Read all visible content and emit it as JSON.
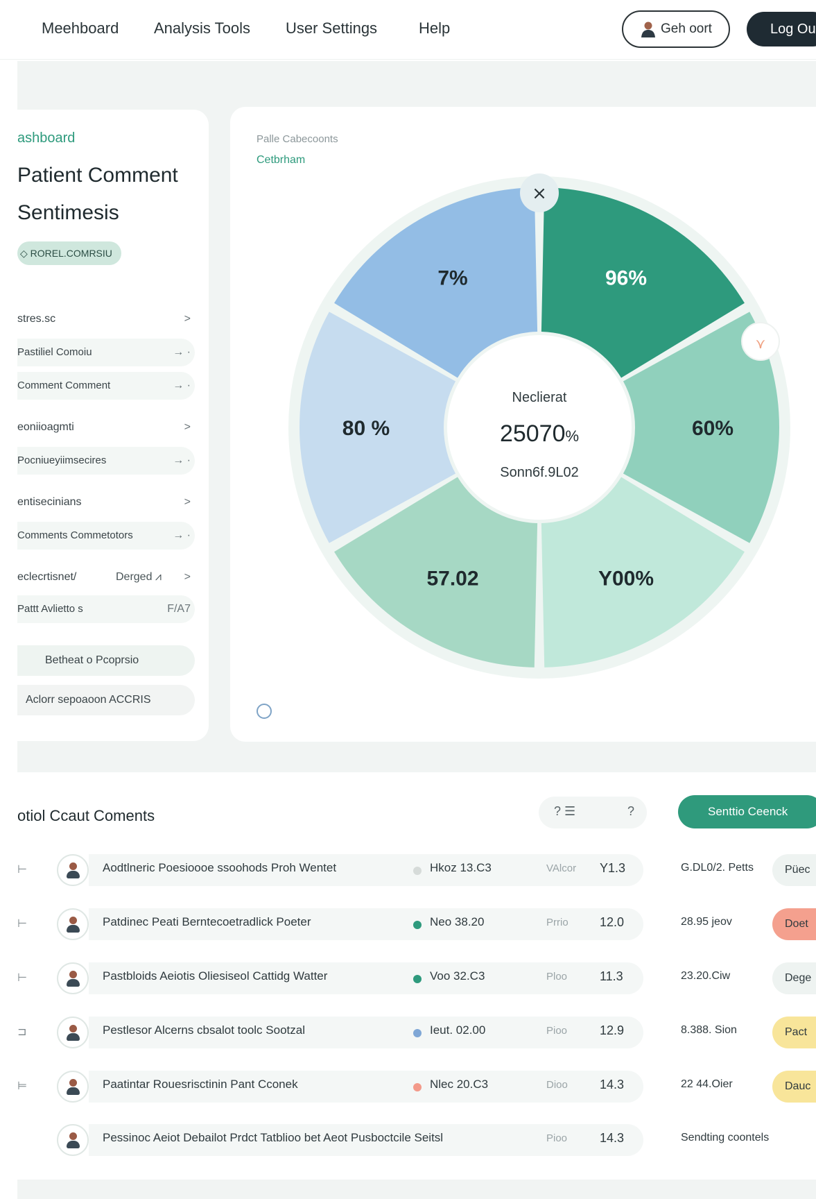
{
  "nav": {
    "items": [
      "Meehboard",
      "Analysis Tools",
      "User Settings",
      "Help"
    ],
    "account_label": "Geh oort",
    "logout_label": "Log Ou"
  },
  "sidebar": {
    "crumb": "ashboard",
    "title_line1": "Patient Comment",
    "title_line2": "Sentimesis",
    "chip_label": "ROREL.COMRSIU",
    "rows": [
      {
        "label": "stres.sc",
        "arrow": ">",
        "sub": false
      },
      {
        "label": "Pastiliel Comoiu",
        "arrow": "→ ·",
        "sub": true
      },
      {
        "label": "Comment Comment",
        "arrow": "→ ·",
        "sub": true
      },
      {
        "label": "eoniioagmti",
        "arrow": ">",
        "sub": false
      },
      {
        "label": "Pocniueyiimsecires",
        "arrow": "→ ·",
        "sub": true
      },
      {
        "label": "entisecinians",
        "arrow": ">",
        "sub": false
      },
      {
        "label": "Comments Commetotors",
        "arrow": "→ ·",
        "sub": true
      },
      {
        "label": "eclecrtisnet/",
        "extra": "Derged ⩘",
        "arrow": ">",
        "sub": false
      },
      {
        "label": "Pattt Avlietto s",
        "arrow": "F/A7",
        "sub": true
      }
    ],
    "actions": [
      "Betheat o Pcoprsio",
      "Aclorr sepoaoon ACCRIS"
    ]
  },
  "chart": {
    "label": "Palle Cabecoonts",
    "sublabel": "Cetbrham",
    "close_icon": "×",
    "marker_icon": "⋎",
    "center_top": "Neclierat",
    "center_value": "25070",
    "center_unit": "%",
    "center_bottom": "Sonn6f.9L02"
  },
  "chart_data": {
    "type": "pie",
    "style": "donut",
    "segments": [
      {
        "label": "96%",
        "value": 96,
        "color": "#2e9a7d"
      },
      {
        "label": "60%",
        "value": 60,
        "color": "#90d0bc"
      },
      {
        "label": "Y00%",
        "value": 100,
        "color": "#c0e8da"
      },
      {
        "label": "57.02",
        "value": 57.02,
        "color": "#a6d8c4"
      },
      {
        "label": "80 %",
        "value": 80,
        "color": "#c6dcef"
      },
      {
        "label": "7%",
        "value": 7,
        "color": "#93bde5"
      }
    ],
    "center_value": "25070%",
    "center_labels": [
      "Neclierat",
      "Sonn6f.9L02"
    ]
  },
  "comments": {
    "title": "otiol Ccaut Coments",
    "filter_left": "? ☰",
    "filter_right": "?",
    "action_label": "Senttio Ceenck",
    "rows": [
      {
        "mark": "⊢",
        "name": "Aodtlneric Poesioooe ssoohods Proh Wentet",
        "dot": "#d6dbd9",
        "date": "Hkoz 13.C3",
        "lbl": "VAlcor",
        "val": "Y1.3",
        "extra": "G.DL0/2. Petts",
        "badge": "Püec",
        "badge_color": "#eef3f1"
      },
      {
        "mark": "⊢",
        "name": "Patdinec Peati Berntecoetradlick Poeter",
        "dot": "#2e9a7d",
        "date": "Neo 38.20",
        "lbl": "Prrio",
        "val": "12.0",
        "extra": "28.95 jeov",
        "badge": "Doet",
        "badge_color": "#f4a08e"
      },
      {
        "mark": "⊢",
        "name": "Pastbloids Aeiotis Oliesiseol Cattidg Watter",
        "dot": "#2e9a7d",
        "date": "Voo 32.C3",
        "lbl": "Ploo",
        "val": "11.3",
        "extra": "23.20.Ciw",
        "badge": "Dege",
        "badge_color": "#eef3f1"
      },
      {
        "mark": "⊐",
        "name": "Pestlesor Alcerns cbsalot toolc Sootzal",
        "dot": "#7fa7d6",
        "date": "Ieut. 02.00",
        "lbl": "Pioo",
        "val": "12.9",
        "extra": "8.388. Sion",
        "badge": "Pact",
        "badge_color": "#f8e59a"
      },
      {
        "mark": "⊨",
        "name": "Paatintar Rouesrisctinin Pant Cconek",
        "dot": "#f39a8a",
        "date": "Nlec 20.C3",
        "lbl": "Dioo",
        "val": "14.3",
        "extra": "22 44.Oier",
        "badge": "Dauc",
        "badge_color": "#f8e59a"
      },
      {
        "mark": "",
        "name": "Pessinoc Aeiot Debailot Prdct Tatblioo bet Aeot Pusboctcile Seitsl",
        "dot": "",
        "date": "",
        "lbl": "Pioo",
        "val": "14.3",
        "extra": "Sendting coontels",
        "badge": "",
        "badge_color": ""
      }
    ]
  }
}
